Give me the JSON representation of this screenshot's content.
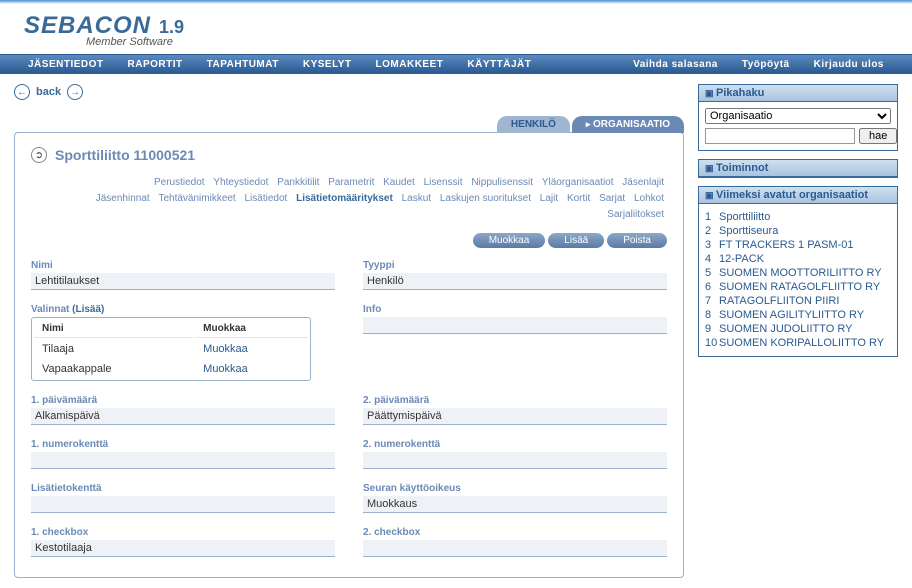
{
  "app": {
    "name": "SEBACON",
    "version": "1.9",
    "subtitle": "Member Software"
  },
  "nav": {
    "left": [
      "JÄSENTIEDOT",
      "RAPORTIT",
      "TAPAHTUMAT",
      "KYSELYT",
      "LOMAKKEET",
      "KÄYTTÄJÄT"
    ],
    "right": [
      "Vaihda salasana",
      "Työpöytä",
      "Kirjaudu ulos"
    ]
  },
  "back_label": "back",
  "tabs": {
    "henkilo": "HENKILÖ",
    "organisaatio": "ORGANISAATIO"
  },
  "page_title": "Sporttiliitto 11000521",
  "subnav": [
    "Perustiedot",
    "Yhteystiedot",
    "Pankkitilit",
    "Parametrit",
    "Kaudet",
    "Lisenssit",
    "Nippulisenssit",
    "Yläorganisaatiot",
    "Jäsenlajit",
    "Jäsenhinnat",
    "Tehtävänimikkeet",
    "Lisätiedot",
    "Lisätietomääritykset",
    "Laskut",
    "Laskujen suoritukset",
    "Lajit",
    "Kortit",
    "Sarjat",
    "Lohkot",
    "Sarjaliitokset"
  ],
  "subnav_current": "Lisätietomääritykset",
  "actions": {
    "edit": "Muokkaa",
    "add": "Lisää",
    "del": "Poista"
  },
  "form": {
    "nimi": {
      "label": "Nimi",
      "value": "Lehtitilaukset"
    },
    "tyyppi": {
      "label": "Tyyppi",
      "value": "Henkilö"
    },
    "valinnat": {
      "label": "Valinnat",
      "extra": "(Lisää)",
      "col1": "Nimi",
      "col2": "Muokkaa",
      "rows": [
        {
          "name": "Tilaaja",
          "action": "Muokkaa"
        },
        {
          "name": "Vapaakappale",
          "action": "Muokkaa"
        }
      ]
    },
    "info": {
      "label": "Info",
      "value": ""
    },
    "pvm1": {
      "label": "1. päivämäärä",
      "value": "Alkamispäivä"
    },
    "pvm2": {
      "label": "2. päivämäärä",
      "value": "Päättymispäivä"
    },
    "num1": {
      "label": "1. numerokenttä",
      "value": ""
    },
    "num2": {
      "label": "2. numerokenttä",
      "value": ""
    },
    "lisa": {
      "label": "Lisätietokenttä",
      "value": ""
    },
    "seura": {
      "label": "Seuran käyttöoikeus",
      "value": "Muokkaus"
    },
    "cb1": {
      "label": "1. checkbox",
      "value": "Kestotilaaja"
    },
    "cb2": {
      "label": "2. checkbox",
      "value": ""
    }
  },
  "side": {
    "pikahaku": {
      "title": "Pikahaku",
      "select": "Organisaatio",
      "button": "hae"
    },
    "toiminnot": {
      "title": "Toiminnot"
    },
    "viimeksi": {
      "title": "Viimeksi avatut organisaatiot",
      "items": [
        "Sporttiliitto",
        "Sporttiseura",
        "FT TRACKERS 1 PASM-01",
        "12-PACK",
        "SUOMEN MOOTTORILIITTO RY",
        "SUOMEN RATAGOLFLIITTO RY",
        "RATAGOLFLIITON PIIRI",
        "SUOMEN AGILITYLIITTO RY",
        "SUOMEN JUDOLIITTO RY",
        "SUOMEN KORIPALLOLIITTO RY"
      ]
    }
  }
}
